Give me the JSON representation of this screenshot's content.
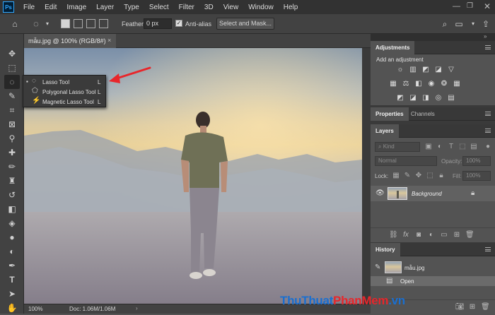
{
  "app": {
    "logo_text": "Ps"
  },
  "menu": [
    "File",
    "Edit",
    "Image",
    "Layer",
    "Type",
    "Select",
    "Filter",
    "3D",
    "View",
    "Window",
    "Help"
  ],
  "options": {
    "feather_label": "Feather:",
    "feather_value": "0 px",
    "antialias_label": "Anti-alias",
    "antialias_checked": true,
    "select_mask_label": "Select and Mask..."
  },
  "document": {
    "tab_title": "mẫu.jpg @ 100% (RGB/8#)",
    "close_glyph": "×"
  },
  "status": {
    "zoom": "100%",
    "doc_info": "Doc: 1.06M/1.06M"
  },
  "flyout": {
    "items": [
      {
        "label": "Lasso Tool",
        "key": "L",
        "icon": "lasso-icon",
        "selected": true
      },
      {
        "label": "Polygonal Lasso Tool",
        "key": "L",
        "icon": "polygonal-lasso-icon",
        "selected": false
      },
      {
        "label": "Magnetic Lasso Tool",
        "key": "L",
        "icon": "magnetic-lasso-icon",
        "selected": false
      }
    ]
  },
  "panels": {
    "adjustments": {
      "tab": "Adjustments",
      "hint": "Add an adjustment"
    },
    "properties_tab": "Properties",
    "channels_tab": "Channels",
    "layers": {
      "tab": "Layers",
      "filter_placeholder": "Kind",
      "blend_mode": "Normal",
      "opacity_label": "Opacity:",
      "opacity_value": "100%",
      "lock_label": "Lock:",
      "fill_label": "Fill:",
      "fill_value": "100%",
      "layer_name": "Background"
    },
    "history": {
      "tab": "History",
      "snapshot": "mẫu.jpg",
      "steps": [
        "Open"
      ]
    }
  },
  "watermark": {
    "part1": "ThuThuat",
    "part2": "PhanMem",
    "part3": ".vn"
  },
  "colors": {
    "accent": "#31a8ff",
    "arrow": "#e8262b",
    "watermark_blue": "#1a6fd0"
  }
}
